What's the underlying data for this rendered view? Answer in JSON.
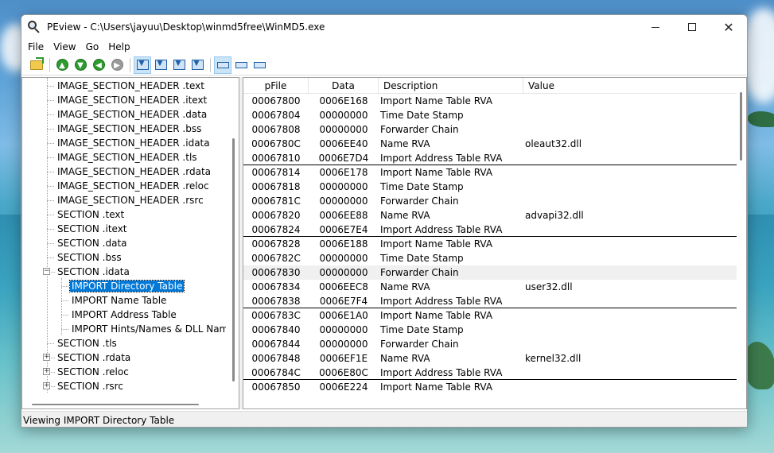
{
  "window": {
    "title": "PEview - C:\\Users\\jayuu\\Desktop\\winmd5free\\WinMD5.exe",
    "minimize_glyph": "—",
    "close_glyph": "✕"
  },
  "menu": [
    "File",
    "View",
    "Go",
    "Help"
  ],
  "toolbar": {
    "icons": [
      "open-file-icon",
      "back-icon",
      "forward-icon",
      "previous-icon",
      "next-icon",
      "view-byte-icon",
      "view-word-icon",
      "view-dword-icon",
      "view-qword-icon",
      "view-save-icon",
      "view-details-icon"
    ]
  },
  "tree": {
    "items": [
      {
        "label": "IMAGE_SECTION_HEADER .text"
      },
      {
        "label": "IMAGE_SECTION_HEADER .itext"
      },
      {
        "label": "IMAGE_SECTION_HEADER .data"
      },
      {
        "label": "IMAGE_SECTION_HEADER .bss"
      },
      {
        "label": "IMAGE_SECTION_HEADER .idata"
      },
      {
        "label": "IMAGE_SECTION_HEADER .tls"
      },
      {
        "label": "IMAGE_SECTION_HEADER .rdata"
      },
      {
        "label": "IMAGE_SECTION_HEADER .reloc"
      },
      {
        "label": "IMAGE_SECTION_HEADER .rsrc"
      },
      {
        "label": "SECTION .text"
      },
      {
        "label": "SECTION .itext"
      },
      {
        "label": "SECTION .data"
      },
      {
        "label": "SECTION .bss"
      },
      {
        "label": "SECTION .idata",
        "expander": "−"
      },
      {
        "label": "IMPORT Directory Table"
      },
      {
        "label": "IMPORT Name Table"
      },
      {
        "label": "IMPORT Address Table"
      },
      {
        "label": "IMPORT Hints/Names & DLL Names"
      },
      {
        "label": "SECTION .tls"
      },
      {
        "label": "SECTION .rdata",
        "expander": "+"
      },
      {
        "label": "SECTION .reloc",
        "expander": "+"
      },
      {
        "label": "SECTION .rsrc",
        "expander": "+"
      }
    ]
  },
  "list": {
    "columns": [
      "pFile",
      "Data",
      "Description",
      "Value"
    ],
    "rows": [
      {
        "pFile": "00067800",
        "data": "0006E168",
        "desc": "Import Name Table RVA",
        "value": ""
      },
      {
        "pFile": "00067804",
        "data": "00000000",
        "desc": "Time Date Stamp",
        "value": ""
      },
      {
        "pFile": "00067808",
        "data": "00000000",
        "desc": "Forwarder Chain",
        "value": ""
      },
      {
        "pFile": "0006780C",
        "data": "0006EE40",
        "desc": "Name RVA",
        "value": "oleaut32.dll"
      },
      {
        "pFile": "00067810",
        "data": "0006E7D4",
        "desc": "Import Address Table RVA",
        "value": ""
      },
      {
        "pFile": "00067814",
        "data": "0006E178",
        "desc": "Import Name Table RVA",
        "value": ""
      },
      {
        "pFile": "00067818",
        "data": "00000000",
        "desc": "Time Date Stamp",
        "value": ""
      },
      {
        "pFile": "0006781C",
        "data": "00000000",
        "desc": "Forwarder Chain",
        "value": ""
      },
      {
        "pFile": "00067820",
        "data": "0006EE88",
        "desc": "Name RVA",
        "value": "advapi32.dll"
      },
      {
        "pFile": "00067824",
        "data": "0006E7E4",
        "desc": "Import Address Table RVA",
        "value": ""
      },
      {
        "pFile": "00067828",
        "data": "0006E188",
        "desc": "Import Name Table RVA",
        "value": ""
      },
      {
        "pFile": "0006782C",
        "data": "00000000",
        "desc": "Time Date Stamp",
        "value": ""
      },
      {
        "pFile": "00067830",
        "data": "00000000",
        "desc": "Forwarder Chain",
        "value": ""
      },
      {
        "pFile": "00067834",
        "data": "0006EEC8",
        "desc": "Name RVA",
        "value": "user32.dll"
      },
      {
        "pFile": "00067838",
        "data": "0006E7F4",
        "desc": "Import Address Table RVA",
        "value": ""
      },
      {
        "pFile": "0006783C",
        "data": "0006E1A0",
        "desc": "Import Name Table RVA",
        "value": ""
      },
      {
        "pFile": "00067840",
        "data": "00000000",
        "desc": "Time Date Stamp",
        "value": ""
      },
      {
        "pFile": "00067844",
        "data": "00000000",
        "desc": "Forwarder Chain",
        "value": ""
      },
      {
        "pFile": "00067848",
        "data": "0006EF1E",
        "desc": "Name RVA",
        "value": "kernel32.dll"
      },
      {
        "pFile": "0006784C",
        "data": "0006E80C",
        "desc": "Import Address Table RVA",
        "value": ""
      },
      {
        "pFile": "00067850",
        "data": "0006E224",
        "desc": "Import Name Table RVA",
        "value": ""
      }
    ]
  },
  "status": {
    "text": "Viewing IMPORT Directory Table"
  },
  "colors": {
    "selection": "#0078d7",
    "toolbar_green": "#2e9b2e"
  }
}
